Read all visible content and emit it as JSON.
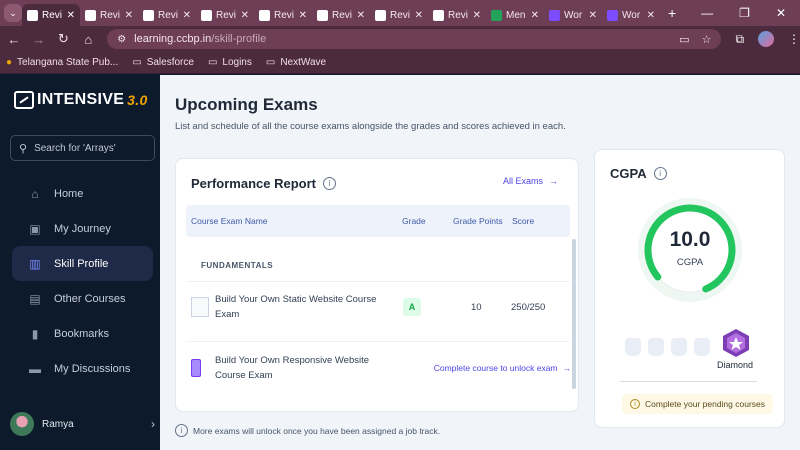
{
  "browser": {
    "tabs": [
      {
        "title": "Revi",
        "favicon_color": "#ffffff",
        "active": true
      },
      {
        "title": "Revi",
        "favicon_color": "#ffffff"
      },
      {
        "title": "Revi",
        "favicon_color": "#ffffff"
      },
      {
        "title": "Revi",
        "favicon_color": "#ffffff"
      },
      {
        "title": "Revi",
        "favicon_color": "#ffffff"
      },
      {
        "title": "Revi",
        "favicon_color": "#ffffff"
      },
      {
        "title": "Revi",
        "favicon_color": "#ffffff"
      },
      {
        "title": "Revi",
        "favicon_color": "#ffffff"
      },
      {
        "title": "Men",
        "favicon_color": "#22a35a"
      },
      {
        "title": "Wor",
        "favicon_color": "#7c4dff"
      },
      {
        "title": "Wor",
        "favicon_color": "#7c4dff"
      }
    ],
    "url_host": "learning.ccbp.in",
    "url_path": "/skill-profile",
    "bookmarks": [
      "Telangana State Pub...",
      "Salesforce",
      "Logins",
      "NextWave"
    ]
  },
  "sidebar": {
    "logo_text": "INTENSIVE",
    "logo_version": "3.0",
    "search_placeholder": "Search for 'Arrays'",
    "items": [
      {
        "label": "Home",
        "icon": "home-icon"
      },
      {
        "label": "My Journey",
        "icon": "journey-icon"
      },
      {
        "label": "Skill Profile",
        "icon": "chart-icon",
        "active": true
      },
      {
        "label": "Other Courses",
        "icon": "book-icon"
      },
      {
        "label": "Bookmarks",
        "icon": "bookmark-icon"
      },
      {
        "label": "My Discussions",
        "icon": "chat-icon"
      }
    ],
    "user_name": "Ramya"
  },
  "main": {
    "title": "Upcoming Exams",
    "subtitle": "List and schedule of all the course exams alongside the grades and scores achieved in each.",
    "footnote": "More exams will unlock once you have been assigned a job track."
  },
  "performance": {
    "title": "Performance Report",
    "all_exams_label": "All Exams",
    "columns": {
      "name": "Course Exam Name",
      "grade": "Grade",
      "grade_points": "Grade Points",
      "score": "Score"
    },
    "section": "FUNDAMENTALS",
    "rows": [
      {
        "name": "Build Your Own Static Website Course Exam",
        "grade": "A",
        "grade_points": "10",
        "score": "250/250"
      },
      {
        "name": "Build Your Own Responsive Website Course Exam",
        "action": "Complete course to unlock exam"
      }
    ]
  },
  "cgpa": {
    "title": "CGPA",
    "value": "10.0",
    "label": "CGPA",
    "gauge_fraction": 0.8,
    "tier_label": "Diamond",
    "pending_text": "Complete your pending courses",
    "colors": {
      "gauge": "#22c55e",
      "accent": "#4f46e5",
      "diamond": "#9b4dca"
    }
  }
}
